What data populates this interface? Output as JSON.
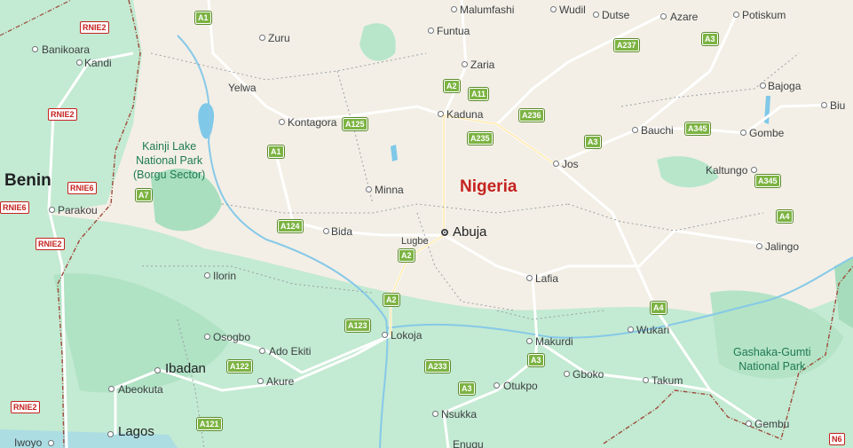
{
  "countries": [
    {
      "id": "benin",
      "name": "Benin"
    },
    {
      "id": "nigeria",
      "name": "Nigeria"
    }
  ],
  "parks": [
    {
      "id": "kainji",
      "lines": [
        "Kainji Lake",
        "National Park",
        "(Borgu Sector)"
      ]
    },
    {
      "id": "gashaka",
      "lines": [
        "Gashaka-Gumti",
        "National Park"
      ]
    }
  ],
  "cities": [
    {
      "id": "abuja",
      "name": "Abuja"
    },
    {
      "id": "lagos",
      "name": "Lagos"
    },
    {
      "id": "ibadan",
      "name": "Ibadan"
    },
    {
      "id": "kaduna",
      "name": "Kaduna"
    },
    {
      "id": "zaria",
      "name": "Zaria"
    },
    {
      "id": "jos",
      "name": "Jos"
    },
    {
      "id": "bauchi",
      "name": "Bauchi"
    },
    {
      "id": "gombe",
      "name": "Gombe"
    },
    {
      "id": "minna",
      "name": "Minna"
    },
    {
      "id": "bida",
      "name": "Bida"
    },
    {
      "id": "lugbe",
      "name": "Lugbe"
    },
    {
      "id": "ilorin",
      "name": "Ilorin"
    },
    {
      "id": "osogbo",
      "name": "Osogbo"
    },
    {
      "id": "ado-ekiti",
      "name": "Ado Ekiti"
    },
    {
      "id": "akure",
      "name": "Akure"
    },
    {
      "id": "abeokuta",
      "name": "Abeokuta"
    },
    {
      "id": "lokoja",
      "name": "Lokoja"
    },
    {
      "id": "lafia",
      "name": "Lafia"
    },
    {
      "id": "makurdi",
      "name": "Makurdi"
    },
    {
      "id": "gboko",
      "name": "Gboko"
    },
    {
      "id": "otukpo",
      "name": "Otukpo"
    },
    {
      "id": "nsukka",
      "name": "Nsukka"
    },
    {
      "id": "enugu",
      "name": "Enugu"
    },
    {
      "id": "wukari",
      "name": "Wukari"
    },
    {
      "id": "takum",
      "name": "Takum"
    },
    {
      "id": "jalingo",
      "name": "Jalingo"
    },
    {
      "id": "gembu",
      "name": "Gembu"
    },
    {
      "id": "kaltungo",
      "name": "Kaltungo"
    },
    {
      "id": "bajoga",
      "name": "Bajoga"
    },
    {
      "id": "biu",
      "name": "Biu"
    },
    {
      "id": "potiskum",
      "name": "Potiskum"
    },
    {
      "id": "azare",
      "name": "Azare"
    },
    {
      "id": "dutse",
      "name": "Dutse"
    },
    {
      "id": "wudil",
      "name": "Wudil"
    },
    {
      "id": "malumfashi",
      "name": "Malumfashi"
    },
    {
      "id": "funtua",
      "name": "Funtua"
    },
    {
      "id": "zuru",
      "name": "Zuru"
    },
    {
      "id": "yelwa",
      "name": "Yelwa"
    },
    {
      "id": "kontagora",
      "name": "Kontagora"
    },
    {
      "id": "kandi",
      "name": "Kandi"
    },
    {
      "id": "banikoara",
      "name": "Banikoara"
    },
    {
      "id": "parakou",
      "name": "Parakou"
    },
    {
      "id": "iwoyo",
      "name": "Iwoyo"
    }
  ],
  "shields": [
    {
      "id": "a1-top",
      "text": "A1",
      "kind": "ng"
    },
    {
      "id": "a237",
      "text": "A237",
      "kind": "ng"
    },
    {
      "id": "a3-top",
      "text": "A3",
      "kind": "ng"
    },
    {
      "id": "a2-zaria",
      "text": "A2",
      "kind": "ng"
    },
    {
      "id": "a11",
      "text": "A11",
      "kind": "ng"
    },
    {
      "id": "a125",
      "text": "A125",
      "kind": "ng"
    },
    {
      "id": "a236",
      "text": "A236",
      "kind": "ng"
    },
    {
      "id": "a235",
      "text": "A235",
      "kind": "ng"
    },
    {
      "id": "a3-jos",
      "text": "A3",
      "kind": "ng"
    },
    {
      "id": "a345-bauchi",
      "text": "A345",
      "kind": "ng"
    },
    {
      "id": "a1-mid",
      "text": "A1",
      "kind": "ng"
    },
    {
      "id": "a7",
      "text": "A7",
      "kind": "ng"
    },
    {
      "id": "a345-kal",
      "text": "A345",
      "kind": "ng"
    },
    {
      "id": "a4-top",
      "text": "A4",
      "kind": "ng"
    },
    {
      "id": "a124",
      "text": "A124",
      "kind": "ng"
    },
    {
      "id": "a2-lugbe",
      "text": "A2",
      "kind": "ng"
    },
    {
      "id": "a2-low",
      "text": "A2",
      "kind": "ng"
    },
    {
      "id": "a4-low",
      "text": "A4",
      "kind": "ng"
    },
    {
      "id": "a123",
      "text": "A123",
      "kind": "ng"
    },
    {
      "id": "a3-mak",
      "text": "A3",
      "kind": "ng"
    },
    {
      "id": "a122",
      "text": "A122",
      "kind": "ng"
    },
    {
      "id": "a233",
      "text": "A233",
      "kind": "ng"
    },
    {
      "id": "a3-otu",
      "text": "A3",
      "kind": "ng"
    },
    {
      "id": "a121",
      "text": "A121",
      "kind": "ng"
    },
    {
      "id": "rnie2-a",
      "text": "RNIE2",
      "kind": "rn"
    },
    {
      "id": "rnie2-b",
      "text": "RNIE2",
      "kind": "rn"
    },
    {
      "id": "rnie6-a",
      "text": "RNIE6",
      "kind": "rn"
    },
    {
      "id": "rnie6-b",
      "text": "RNIE6",
      "kind": "rn"
    },
    {
      "id": "rnie2-c",
      "text": "RNIE2",
      "kind": "rn"
    },
    {
      "id": "rnie2-d",
      "text": "RNIE2",
      "kind": "rn"
    },
    {
      "id": "n6",
      "text": "N6",
      "kind": "rn"
    }
  ],
  "colors": {
    "land": "#f3efe6",
    "green": "#bfe8cf",
    "darkgreen": "#a6dcbb",
    "water": "#7fc8e8",
    "road": "#ffffff",
    "border": "#9e4a3a"
  }
}
